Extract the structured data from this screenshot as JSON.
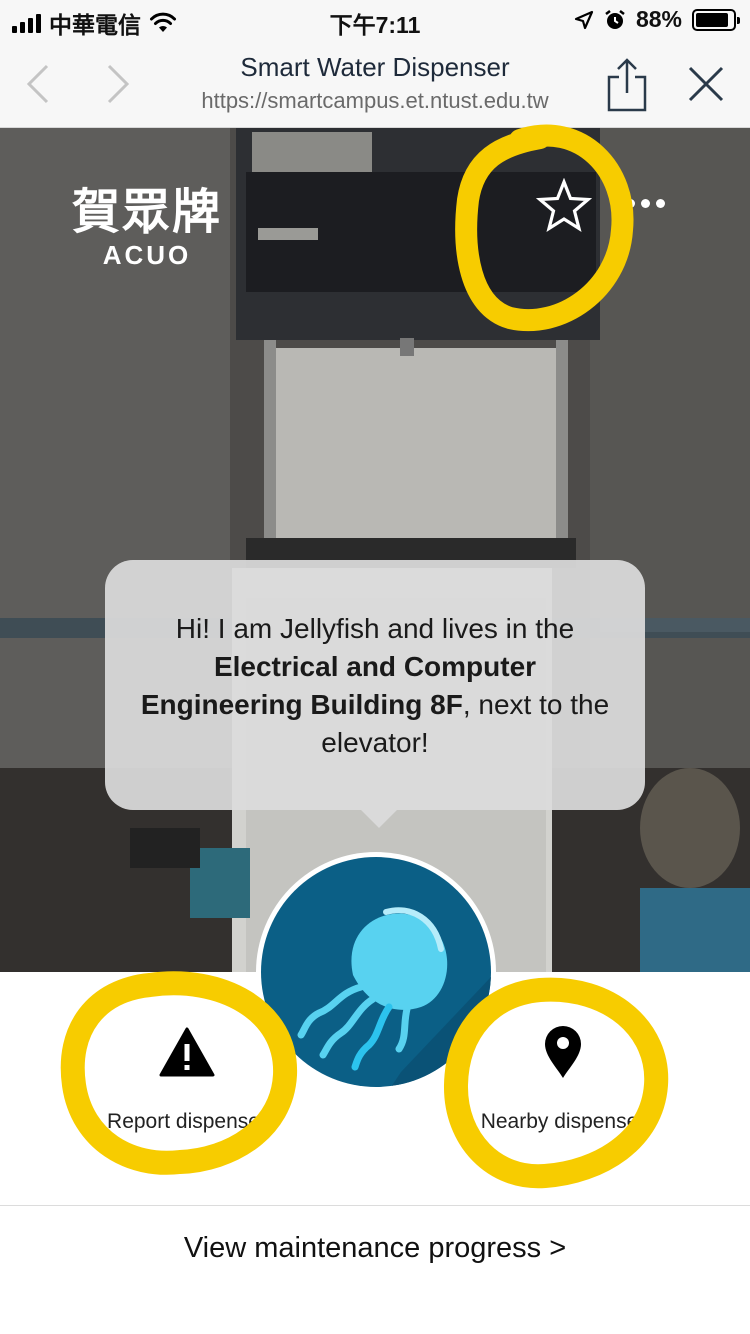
{
  "status_bar": {
    "carrier": "中華電信",
    "time": "下午7:11",
    "battery_percent": "88%",
    "battery_level": 0.88
  },
  "browser": {
    "title": "Smart Water Dispenser",
    "url": "https://smartcampus.et.ntust.edu.tw"
  },
  "hero": {
    "brand_cn": "賀眾牌",
    "brand_en": "ACUO",
    "bubble": {
      "intro": "Hi! I am Jellyfish and lives in the",
      "location": "Electrical and Computer Engineering Building 8F",
      "suffix": ", next to the elevator!"
    }
  },
  "actions": {
    "report_label": "Report dispenser",
    "nearby_label": "Nearby dispenser"
  },
  "footer": {
    "progress_link": "View maintenance progress >"
  },
  "colors": {
    "markup_yellow": "#f7cc00",
    "avatar_bg": "#0b5f86",
    "jellyfish": "#4fd0f0"
  }
}
